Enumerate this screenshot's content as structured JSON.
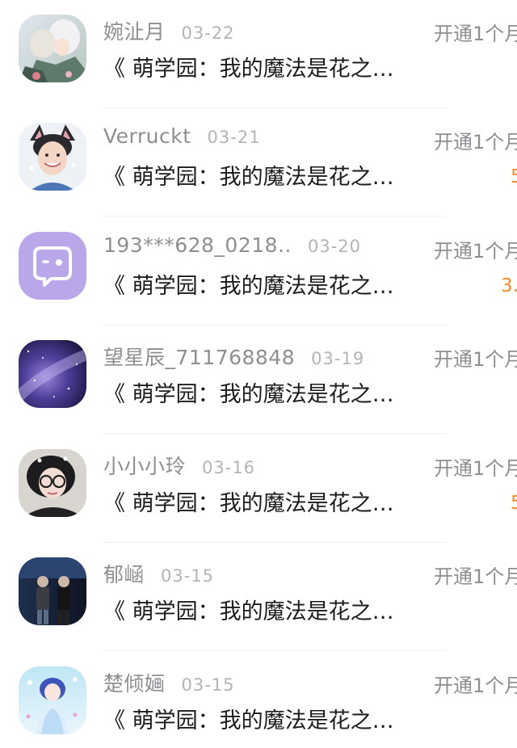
{
  "records": [
    {
      "name": "婉沚月",
      "date": "03-22",
      "content": "《 萌学园：我的魔法是花之…",
      "action": "开通1个月",
      "amount": "",
      "avatar_icon": "anime-couple-avatar"
    },
    {
      "name": "Verruckt",
      "date": "03-21",
      "content": "《 萌学园：我的魔法是花之…",
      "action": "开通1个月",
      "amount": "5",
      "avatar_icon": "cat-ears-avatar"
    },
    {
      "name": "193***628_0218..",
      "date": "03-20",
      "content": "《 萌学园：我的魔法是花之…",
      "action": "开通1个月",
      "amount": "3.",
      "avatar_icon": "default-chat-avatar"
    },
    {
      "name": "望星辰_711768848",
      "date": "03-19",
      "content": "《 萌学园：我的魔法是花之…",
      "action": "开通1个月",
      "amount": "",
      "avatar_icon": "galaxy-avatar"
    },
    {
      "name": "小小小玲",
      "date": "03-16",
      "content": "《 萌学园：我的魔法是花之…",
      "action": "开通1个月",
      "amount": "5",
      "avatar_icon": "girl-selfie-avatar"
    },
    {
      "name": "郁崡",
      "date": "03-15",
      "content": "《 萌学园：我的魔法是花之…",
      "action": "开通1个月",
      "amount": "",
      "avatar_icon": "street-couple-avatar"
    },
    {
      "name": "楚倾婳",
      "date": "03-15",
      "content": "《 萌学园：我的魔法是花之…",
      "action": "开通1个月",
      "amount": "",
      "avatar_icon": "anime-princess-avatar"
    }
  ],
  "colors": {
    "name": "#8e8e93",
    "date": "#b4b4b8",
    "content": "#1c1c1e",
    "amount": "#f28b2a",
    "default_avatar_bg": "#b9a7ea"
  }
}
